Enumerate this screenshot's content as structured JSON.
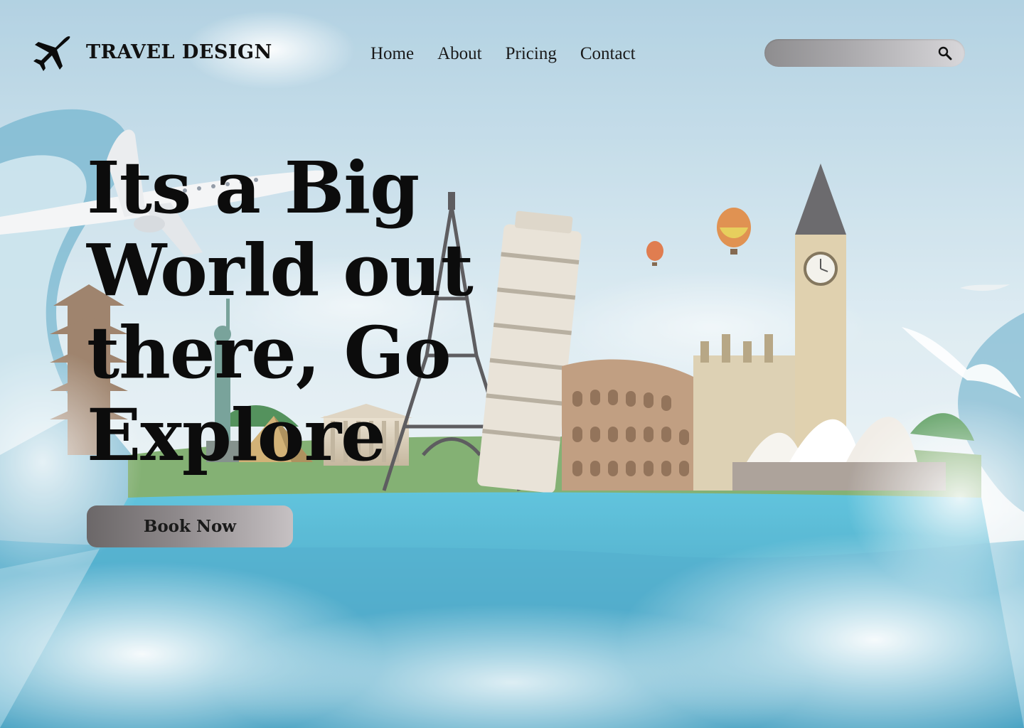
{
  "header": {
    "logo_icon": "airplane-icon",
    "brand": "TRAVEL DESIGN",
    "nav": [
      {
        "label": "Home"
      },
      {
        "label": "About"
      },
      {
        "label": "Pricing"
      },
      {
        "label": "Contact"
      }
    ],
    "search": {
      "placeholder": "",
      "value": "",
      "icon": "search-icon"
    }
  },
  "hero": {
    "title": "Its a Big World out there, Go Explore",
    "cta_label": "Book Now"
  },
  "colors": {
    "sky": "#a9cfe0",
    "text": "#0c0c0c",
    "button_gradient_start": "#6b6768",
    "button_gradient_end": "#c6c1c3",
    "search_gradient_start": "#8e8d8f",
    "search_gradient_end": "#d8d7da"
  }
}
